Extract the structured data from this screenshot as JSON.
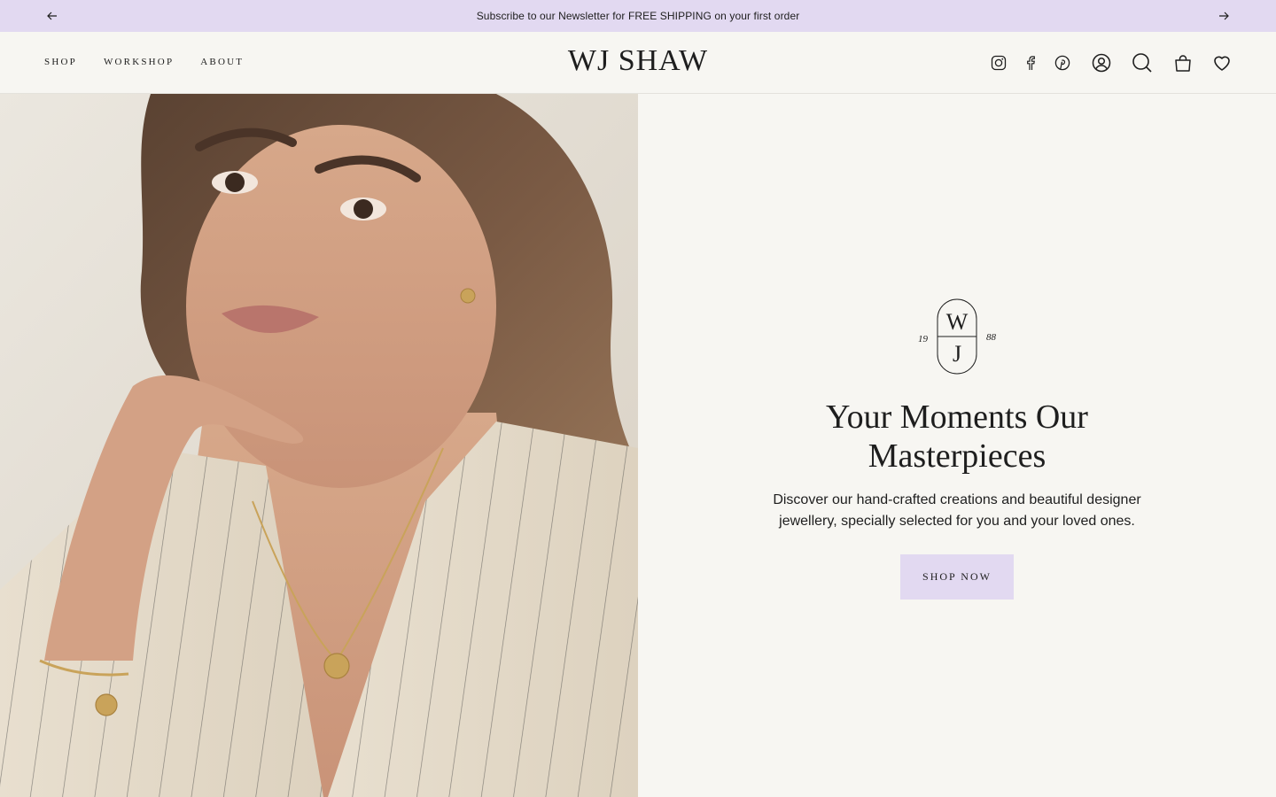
{
  "announcement": {
    "text": "Subscribe to our Newsletter for FREE SHIPPING on your first order"
  },
  "header": {
    "logo": "WJ SHAW",
    "nav": [
      {
        "label": "SHOP"
      },
      {
        "label": "WORKSHOP"
      },
      {
        "label": "ABOUT"
      }
    ],
    "icons": [
      "instagram-icon",
      "facebook-icon",
      "pinterest-icon",
      "account-icon",
      "search-icon",
      "cart-icon",
      "wishlist-heart-icon"
    ]
  },
  "hero": {
    "image_alt": "Model wearing gold coin pendant necklace, stud earrings and bracelet",
    "monogram": {
      "top": "W",
      "bottom": "J",
      "year_left": "19",
      "year_right": "88"
    },
    "title": "Your Moments Our Masterpieces",
    "description": "Discover our hand-crafted creations and beautiful designer jewellery, specially selected for you and your loved ones.",
    "button_label": "SHOP NOW"
  },
  "colors": {
    "accent": "#e2d9f1",
    "background": "#f7f6f2",
    "text": "#1e1e1e"
  }
}
